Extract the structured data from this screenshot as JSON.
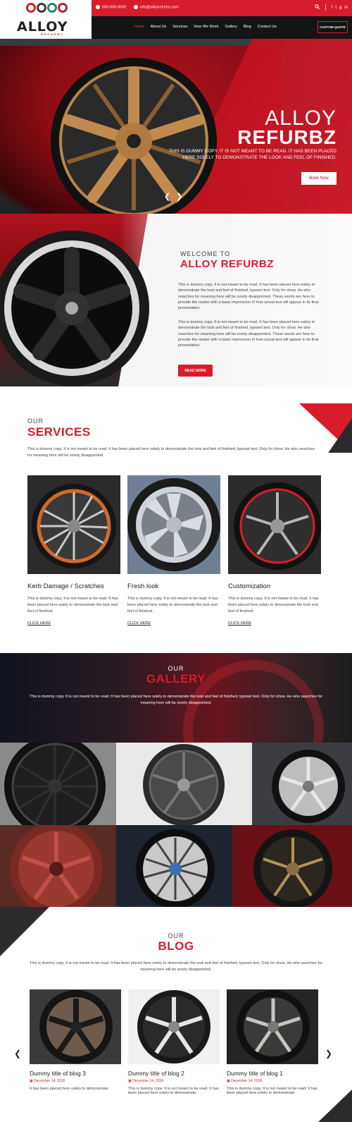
{
  "header": {
    "phone": "000-000-0000",
    "email": "info@alloyrefurbz.com",
    "logo_word": "ALLOY",
    "logo_sub": "REFURBZ",
    "nav": [
      "Home",
      "About Us",
      "Services",
      "How We Work",
      "Gallery",
      "Blog",
      "Contact Us"
    ],
    "quote_button": "CUSTOM QUOTE",
    "social": [
      "f",
      "t",
      "g",
      "in"
    ]
  },
  "hero": {
    "title_line1": "ALLOY",
    "title_line2": "REFURBZ",
    "text": "THIS IS DUMMY COPY. IT IS NOT MEANT TO BE READ. IT HAS BEEN PLACED HERE SOLELY TO DEMONSTRATE THE LOOK AND FEEL OF FINISHED.",
    "button": "Book Now",
    "prev": "❮",
    "next": "❯"
  },
  "welcome": {
    "kicker": "WELCOME TO",
    "title": "ALLOY REFURBZ",
    "para1": "This is dummy copy. It is not meant to be read. It has been placed here solely to demonstrate the look and feel of finished, typeset text. Only for show. He who searches for meaning here will be sorely disappointed. These words are here to provide the reader with a basic impression of how actual text will appear in its final presentation.",
    "para2": "This is dummy copy. It is not meant to be read. It has been placed here solely to demonstrate the look and feel of finished, typeset text. Only for show. He who searches for meaning here will be sorely disappointed. These words are here to provide the reader with a basic impression of how actual text will appear in its final presentation.",
    "button": "READ MORE"
  },
  "services": {
    "kicker": "OUR",
    "title": "SERVICES",
    "text": "This is dummy copy. It is not meant to be read. It has been placed here solely to demonstrate the look and feel of finished, typeset text. Only for show. He who searches for meaning here will be sorely disappointed.",
    "items": [
      {
        "name": "Kerb Damage / Scratches",
        "desc": "This is dummy copy. It is not meant to be read. It has been placed here solely to demonstrate the look and feel of finished.",
        "link": "CLICK HERE"
      },
      {
        "name": "Fresh look",
        "desc": "This is dummy copy. It is not meant to be read. It has been placed here solely to demonstrate the look and feel of finished.",
        "link": "CLICK HERE"
      },
      {
        "name": "Customization",
        "desc": "This is dummy copy. It is not meant to be read. It has been placed here solely to demonstrate the look and feel of finished.",
        "link": "CLICK HERE"
      }
    ]
  },
  "gallery": {
    "kicker": "OUR",
    "title": "GALLERY",
    "text": "This is dummy copy. It is not meant to be read. It has been placed here solely to demonstrate the look and feel of finished, typeset text. Only for show. He who searches for meaning here will be sorely disappointed."
  },
  "blog": {
    "kicker": "OUR",
    "title": "BLOG",
    "text": "This is dummy copy. It is not meant to be read. It has been placed here solely to demonstrate the look and feel of finished, typeset text. Only for show. He who searches for meaning here will be sorely disappointed.",
    "prev": "❮",
    "next": "❯",
    "posts": [
      {
        "title": "Dummy title of blog 3",
        "date": "December 14, 2018",
        "excerpt": "It has been placed here solely to demonstrate."
      },
      {
        "title": "Dummy title of blog 2",
        "date": "December 14, 2018",
        "excerpt": "This is dummy copy. It is not meant to be read. It has been placed here solely to demonstrate."
      },
      {
        "title": "Dummy title of blog 1",
        "date": "December 14, 2018",
        "excerpt": "This is dummy copy. It is not meant to be read. It has been placed here solely to demonstrate."
      }
    ]
  },
  "colors": {
    "brand_red": "#d71d2b",
    "dark": "#141414"
  }
}
